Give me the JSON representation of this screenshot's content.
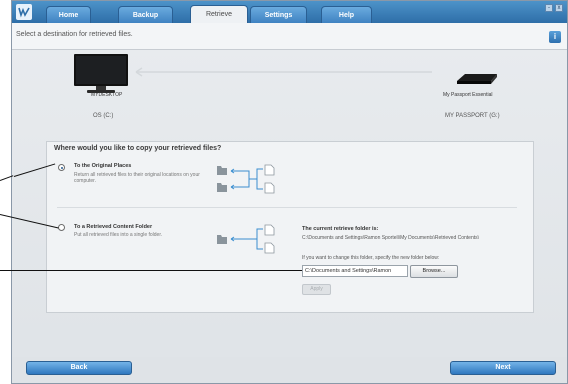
{
  "window": {
    "tabs": [
      {
        "label": "Home"
      },
      {
        "label": "Backup"
      },
      {
        "label": "Retrieve"
      },
      {
        "label": "Settings"
      },
      {
        "label": "Help"
      }
    ],
    "active_tab": "Retrieve",
    "controls": {
      "minimize": "-",
      "close": "x"
    }
  },
  "header": {
    "instruction": "Select a destination for retrieved files.",
    "info_symbol": "i"
  },
  "devices": {
    "source": {
      "name": "MYDESKTOP",
      "drive": "OS (C:)"
    },
    "target": {
      "name": "My Passport Essential",
      "drive": "MY PASSPORT (G:)"
    }
  },
  "question": "Where would you like to copy your retrieved files?",
  "options": [
    {
      "title": "To the Original Places",
      "description": "Return all retrieved files to their original locations on your computer.",
      "selected": true
    },
    {
      "title": "To a Retrieved Content Folder",
      "description": "Put all retrieved files into a single folder.",
      "selected": false
    }
  ],
  "retrieve_folder": {
    "title": "The current retrieve folder is:",
    "path": "C:\\Documents and Settings\\Ramon Sporteli\\My Documents\\Retrieved Contents\\",
    "change_prompt": "If you want to change this folder, specify the new folder below:",
    "input_value": "C:\\Documents and Settings\\Ramon",
    "browse_label": "Browse...",
    "apply_label": "Apply"
  },
  "footer": {
    "back_label": "Back",
    "next_label": "Next"
  }
}
